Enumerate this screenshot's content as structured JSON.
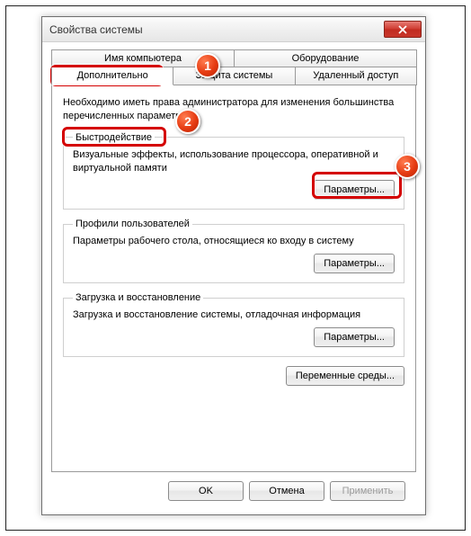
{
  "window": {
    "title": "Свойства системы"
  },
  "tabs": {
    "row1": [
      {
        "label": "Имя компьютера"
      },
      {
        "label": "Оборудование"
      }
    ],
    "row2": [
      {
        "label": "Дополнительно",
        "active": true
      },
      {
        "label": "Защита системы"
      },
      {
        "label": "Удаленный доступ"
      }
    ]
  },
  "intro": "Необходимо иметь права администратора для изменения большинства перечисленных параметров.",
  "groups": {
    "performance": {
      "legend": "Быстродействие",
      "desc": "Визуальные эффекты, использование процессора, оперативной и виртуальной памяти",
      "button": "Параметры..."
    },
    "profiles": {
      "legend": "Профили пользователей",
      "desc": "Параметры рабочего стола, относящиеся ко входу в систему",
      "button": "Параметры..."
    },
    "startup": {
      "legend": "Загрузка и восстановление",
      "desc": "Загрузка и восстановление системы, отладочная информация",
      "button": "Параметры..."
    }
  },
  "envvars_button": "Переменные среды...",
  "buttons": {
    "ok": "OK",
    "cancel": "Отмена",
    "apply": "Применить"
  },
  "annotations": {
    "b1": "1",
    "b2": "2",
    "b3": "3"
  }
}
